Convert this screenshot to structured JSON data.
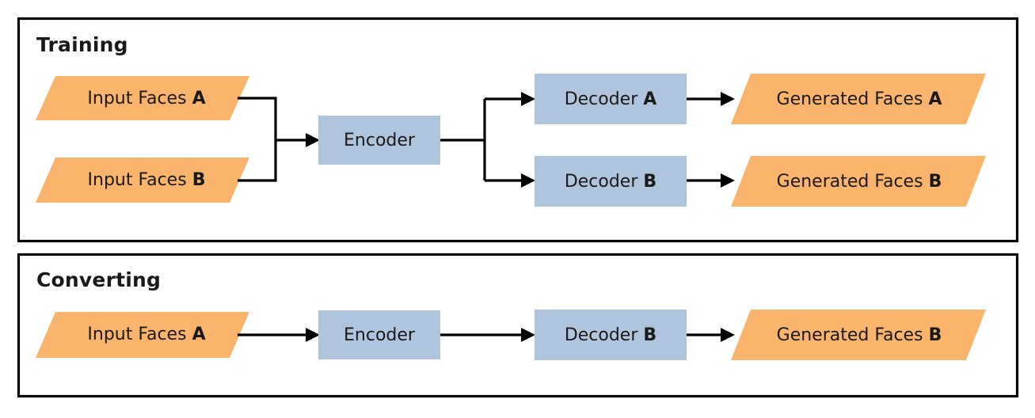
{
  "figure": {
    "background_color": "#ffffff",
    "border_color": "#000000",
    "shape_colors": {
      "process_blue": "#aec5dd",
      "data_orange": "#fab46c",
      "connector_black": "#000000",
      "text_black": "#1a1a1a"
    }
  },
  "panels": [
    {
      "id": "training",
      "title": "Training",
      "nodes": {
        "input_a": {
          "label_main": "Input Faces ",
          "label_bold": "A",
          "shape": "parallelogram",
          "color": "#fab46c"
        },
        "input_b": {
          "label_main": "Input Faces ",
          "label_bold": "B",
          "shape": "parallelogram",
          "color": "#fab46c"
        },
        "encoder": {
          "label_main": "Encoder",
          "label_bold": "",
          "shape": "rectangle",
          "color": "#aec5dd"
        },
        "decoder_a": {
          "label_main": "Decoder ",
          "label_bold": "A",
          "shape": "rectangle",
          "color": "#aec5dd"
        },
        "decoder_b": {
          "label_main": "Decoder ",
          "label_bold": "B",
          "shape": "rectangle",
          "color": "#aec5dd"
        },
        "generated_a": {
          "label_main": "Generated Faces ",
          "label_bold": "A",
          "shape": "parallelogram",
          "color": "#fab46c"
        },
        "generated_b": {
          "label_main": "Generated Faces ",
          "label_bold": "B",
          "shape": "parallelogram",
          "color": "#fab46c"
        }
      },
      "edges": [
        {
          "from": "input_a",
          "to": "encoder",
          "style": "elbow-merge"
        },
        {
          "from": "input_b",
          "to": "encoder",
          "style": "elbow-merge"
        },
        {
          "from": "encoder",
          "to": "decoder_a",
          "style": "elbow-split"
        },
        {
          "from": "encoder",
          "to": "decoder_b",
          "style": "elbow-split"
        },
        {
          "from": "decoder_a",
          "to": "generated_a",
          "style": "straight"
        },
        {
          "from": "decoder_b",
          "to": "generated_b",
          "style": "straight"
        }
      ]
    },
    {
      "id": "converting",
      "title": "Converting",
      "nodes": {
        "input_a": {
          "label_main": "Input Faces ",
          "label_bold": "A",
          "shape": "parallelogram",
          "color": "#fab46c"
        },
        "encoder": {
          "label_main": "Encoder",
          "label_bold": "",
          "shape": "rectangle",
          "color": "#aec5dd"
        },
        "decoder_b": {
          "label_main": "Decoder ",
          "label_bold": "B",
          "shape": "rectangle",
          "color": "#aec5dd"
        },
        "generated_b": {
          "label_main": "Generated Faces ",
          "label_bold": "B",
          "shape": "parallelogram",
          "color": "#fab46c"
        }
      },
      "edges": [
        {
          "from": "input_a",
          "to": "encoder",
          "style": "straight"
        },
        {
          "from": "encoder",
          "to": "decoder_b",
          "style": "straight"
        },
        {
          "from": "decoder_b",
          "to": "generated_b",
          "style": "straight"
        }
      ]
    }
  ]
}
